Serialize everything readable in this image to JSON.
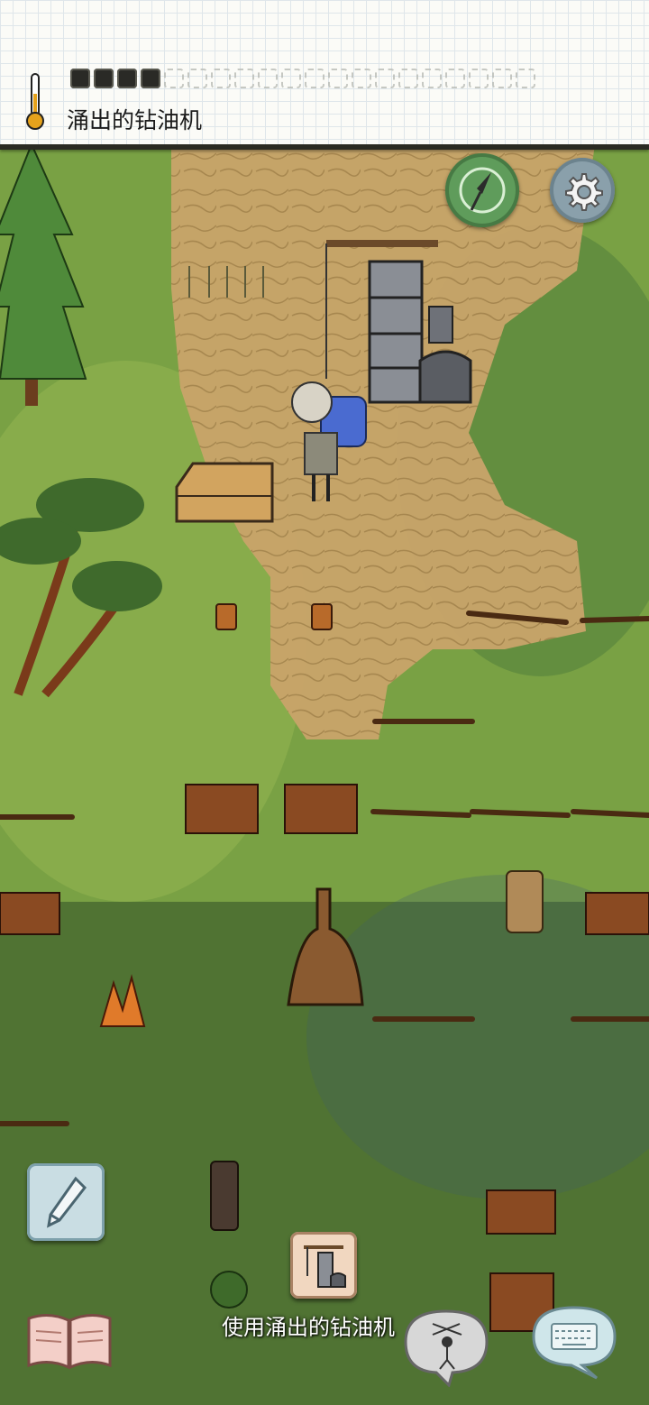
{
  "status": {
    "text": "涌出的钻油机",
    "food_pips_total": 20,
    "food_pips_filled": 4
  },
  "action": {
    "label": "使用涌出的钻油机"
  },
  "controls": {
    "compass_icon": "compass-icon",
    "settings_icon": "gear-icon",
    "note_icon": "pencil-icon",
    "book_icon": "book-icon",
    "emote_icon": "puppet-icon",
    "chat_icon": "keyboard-icon"
  }
}
